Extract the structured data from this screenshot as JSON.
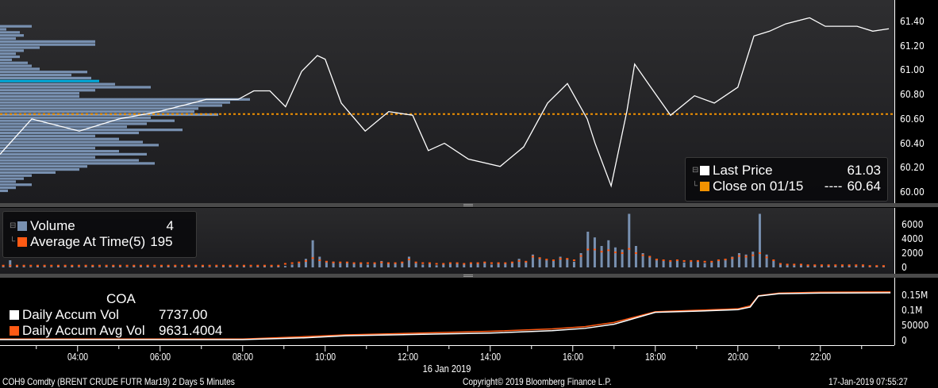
{
  "price_legend": {
    "last_label": "Last Price",
    "last_value": "61.03",
    "close_label": "Close on 01/15",
    "close_dashes": "----",
    "close_value": "60.64"
  },
  "volume_legend": {
    "volume_label": "Volume",
    "volume_value": "4",
    "avg_label": "Average At Time(5)",
    "avg_value": "195"
  },
  "accum_legend": {
    "title": "COA",
    "vol_label": "Daily Accum Vol",
    "vol_value": "7737.00",
    "avg_label": "Daily Accum Avg Vol",
    "avg_value": "9631.4004"
  },
  "price_axis": [
    "61.40",
    "61.20",
    "61.00",
    "60.80",
    "60.60",
    "60.40",
    "60.20",
    "60.00"
  ],
  "volume_axis": [
    "6000",
    "4000",
    "2000",
    "0"
  ],
  "accum_axis": [
    "0.15M",
    "0.1M",
    "50000",
    "0"
  ],
  "time_axis": [
    "04:00",
    "06:00",
    "08:00",
    "10:00",
    "12:00",
    "14:00",
    "16:00",
    "18:00",
    "20:00",
    "22:00"
  ],
  "date_label": "16 Jan 2019",
  "footer": {
    "security": "COH9 Comdty (BRENT CRUDE FUTR  Mar19) 2 Days 5 Minutes",
    "copyright": "Copyright© 2019 Bloomberg Finance L.P.",
    "timestamp": "17-Jan-2019 07:55:27"
  },
  "colors": {
    "price": "#ffffff",
    "close": "#f39200",
    "volume": "#7890b0",
    "avg": "#ff5a14",
    "profile": "#7890b0",
    "profile_peak": "#00aee0",
    "accum": "#ffffff",
    "accum_avg": "#ff5a14"
  },
  "chart_data": [
    {
      "type": "line",
      "title": "Last Price",
      "ylim": [
        60.0,
        61.4
      ],
      "close_level": 60.64,
      "x_unit": "hour of 16 Jan 2019",
      "points": [
        [
          2.12,
          60.31
        ],
        [
          2.89,
          60.6
        ],
        [
          4.04,
          60.5
        ],
        [
          5.0,
          60.6
        ],
        [
          5.97,
          60.66
        ],
        [
          7.12,
          60.76
        ],
        [
          7.89,
          60.76
        ],
        [
          8.27,
          60.83
        ],
        [
          8.66,
          60.83
        ],
        [
          9.04,
          60.7
        ],
        [
          9.43,
          60.99
        ],
        [
          9.81,
          61.12
        ],
        [
          10.0,
          61.09
        ],
        [
          10.39,
          60.73
        ],
        [
          10.97,
          60.5
        ],
        [
          11.54,
          60.66
        ],
        [
          12.12,
          60.63
        ],
        [
          12.5,
          60.34
        ],
        [
          12.89,
          60.4
        ],
        [
          13.47,
          60.27
        ],
        [
          14.24,
          60.21
        ],
        [
          14.81,
          60.37
        ],
        [
          15.39,
          60.73
        ],
        [
          15.87,
          60.89
        ],
        [
          16.35,
          60.6
        ],
        [
          16.54,
          60.4
        ],
        [
          16.93,
          60.05
        ],
        [
          17.31,
          60.66
        ],
        [
          17.5,
          61.05
        ],
        [
          17.89,
          60.86
        ],
        [
          18.37,
          60.63
        ],
        [
          18.95,
          60.79
        ],
        [
          19.43,
          60.73
        ],
        [
          20.0,
          60.86
        ],
        [
          20.39,
          61.28
        ],
        [
          20.77,
          61.32
        ],
        [
          21.16,
          61.38
        ],
        [
          21.74,
          61.43
        ],
        [
          22.12,
          61.36
        ],
        [
          22.89,
          61.36
        ],
        [
          23.27,
          61.32
        ],
        [
          23.66,
          61.34
        ]
      ],
      "volume_profile": {
        "price_top": 61.36,
        "price_step": 0.025,
        "peak_price": 60.9,
        "values": [
          40,
          8,
          25,
          30,
          20,
          120,
          120,
          50,
          30,
          20,
          25,
          15,
          35,
          40,
          50,
          110,
          90,
          115,
          125,
          145,
          190,
          120,
          100,
          100,
          315,
          290,
          280,
          250,
          245,
          275,
          190,
          220,
          185,
          160,
          230,
          175,
          120,
          150,
          180,
          200,
          120,
          150,
          185,
          120,
          175,
          195,
          110,
          100,
          70,
          40,
          30,
          20,
          40,
          20,
          10
        ]
      }
    },
    {
      "type": "bar",
      "title": "Volume",
      "ylim": [
        0,
        7500
      ],
      "start_hour": 2.17,
      "interval_minutes": 10,
      "values": [
        150,
        1000,
        200,
        150,
        100,
        200,
        150,
        100,
        200,
        150,
        200,
        100,
        150,
        200,
        100,
        150,
        200,
        150,
        100,
        200,
        150,
        200,
        100,
        150,
        200,
        150,
        100,
        200,
        150,
        200,
        100,
        150,
        200,
        250,
        150,
        200,
        100,
        150,
        200,
        150,
        200,
        200,
        400,
        600,
        1200,
        3800,
        1500,
        900,
        800,
        600,
        700,
        500,
        600,
        400,
        500,
        900,
        600,
        500,
        700,
        1500,
        600,
        400,
        500,
        300,
        400,
        500,
        600,
        400,
        500,
        600,
        700,
        400,
        600,
        500,
        700,
        1200,
        800,
        1800,
        1400,
        1000,
        900,
        1500,
        1200,
        800,
        2000,
        5000,
        4200,
        3000,
        3800,
        2800,
        2500,
        7500,
        3000,
        2000,
        1500,
        1200,
        900,
        800,
        1000,
        700,
        800,
        900,
        600,
        700,
        1000,
        1200,
        1500,
        2000,
        1800,
        2200,
        7500,
        1800,
        900,
        500,
        400,
        300,
        400,
        300,
        300,
        200,
        300,
        200,
        200,
        300,
        200,
        200,
        100,
        200,
        100
      ],
      "avg_values": [
        250,
        250,
        250,
        250,
        250,
        250,
        250,
        250,
        250,
        250,
        250,
        250,
        250,
        250,
        250,
        250,
        250,
        250,
        250,
        250,
        250,
        250,
        250,
        250,
        250,
        250,
        250,
        250,
        250,
        250,
        250,
        250,
        250,
        250,
        250,
        250,
        250,
        250,
        250,
        250,
        250,
        500,
        600,
        700,
        900,
        1300,
        1000,
        800,
        700,
        700,
        700,
        600,
        600,
        600,
        600,
        700,
        600,
        600,
        700,
        1100,
        700,
        600,
        600,
        500,
        500,
        600,
        600,
        500,
        600,
        600,
        700,
        600,
        600,
        600,
        700,
        900,
        800,
        1500,
        1300,
        1100,
        1000,
        1200,
        1200,
        1000,
        1600,
        2500,
        2500,
        2200,
        2400,
        2100,
        2000,
        2600,
        2000,
        1700,
        1500,
        1100,
        1000,
        900,
        1000,
        900,
        900,
        900,
        800,
        800,
        1000,
        1100,
        1300,
        1600,
        1500,
        1700,
        2000,
        1400,
        1000,
        500,
        400,
        400,
        400,
        300,
        300,
        300,
        300,
        300,
        300,
        300,
        300,
        300,
        200,
        200,
        200
      ]
    },
    {
      "type": "line",
      "title": "Daily Accum Vol",
      "ylim": [
        0,
        180000
      ],
      "series": [
        {
          "name": "Daily Accum Vol",
          "points": [
            [
              0.0,
              0
            ],
            [
              8.0,
              0
            ],
            [
              9.5,
              6000
            ],
            [
              10.5,
              13000
            ],
            [
              12.0,
              17000
            ],
            [
              14.0,
              22000
            ],
            [
              15.5,
              30000
            ],
            [
              16.3,
              38000
            ],
            [
              17.0,
              52000
            ],
            [
              17.5,
              72000
            ],
            [
              18.0,
              92000
            ],
            [
              19.0,
              96000
            ],
            [
              20.0,
              101000
            ],
            [
              20.3,
              110000
            ],
            [
              20.5,
              147000
            ],
            [
              21.0,
              155000
            ],
            [
              22.0,
              157000
            ],
            [
              23.7,
              158000
            ]
          ]
        },
        {
          "name": "Daily Accum Avg Vol",
          "points": [
            [
              0.0,
              2000
            ],
            [
              8.0,
              2000
            ],
            [
              9.5,
              10000
            ],
            [
              10.5,
              16000
            ],
            [
              12.0,
              21000
            ],
            [
              14.0,
              28000
            ],
            [
              15.5,
              36000
            ],
            [
              16.3,
              44000
            ],
            [
              17.0,
              58000
            ],
            [
              17.5,
              76000
            ],
            [
              18.0,
              94000
            ],
            [
              19.0,
              99000
            ],
            [
              20.0,
              104000
            ],
            [
              20.3,
              114000
            ],
            [
              20.5,
              148000
            ],
            [
              21.0,
              157000
            ],
            [
              22.0,
              160000
            ],
            [
              23.7,
              161000
            ]
          ]
        }
      ]
    }
  ]
}
